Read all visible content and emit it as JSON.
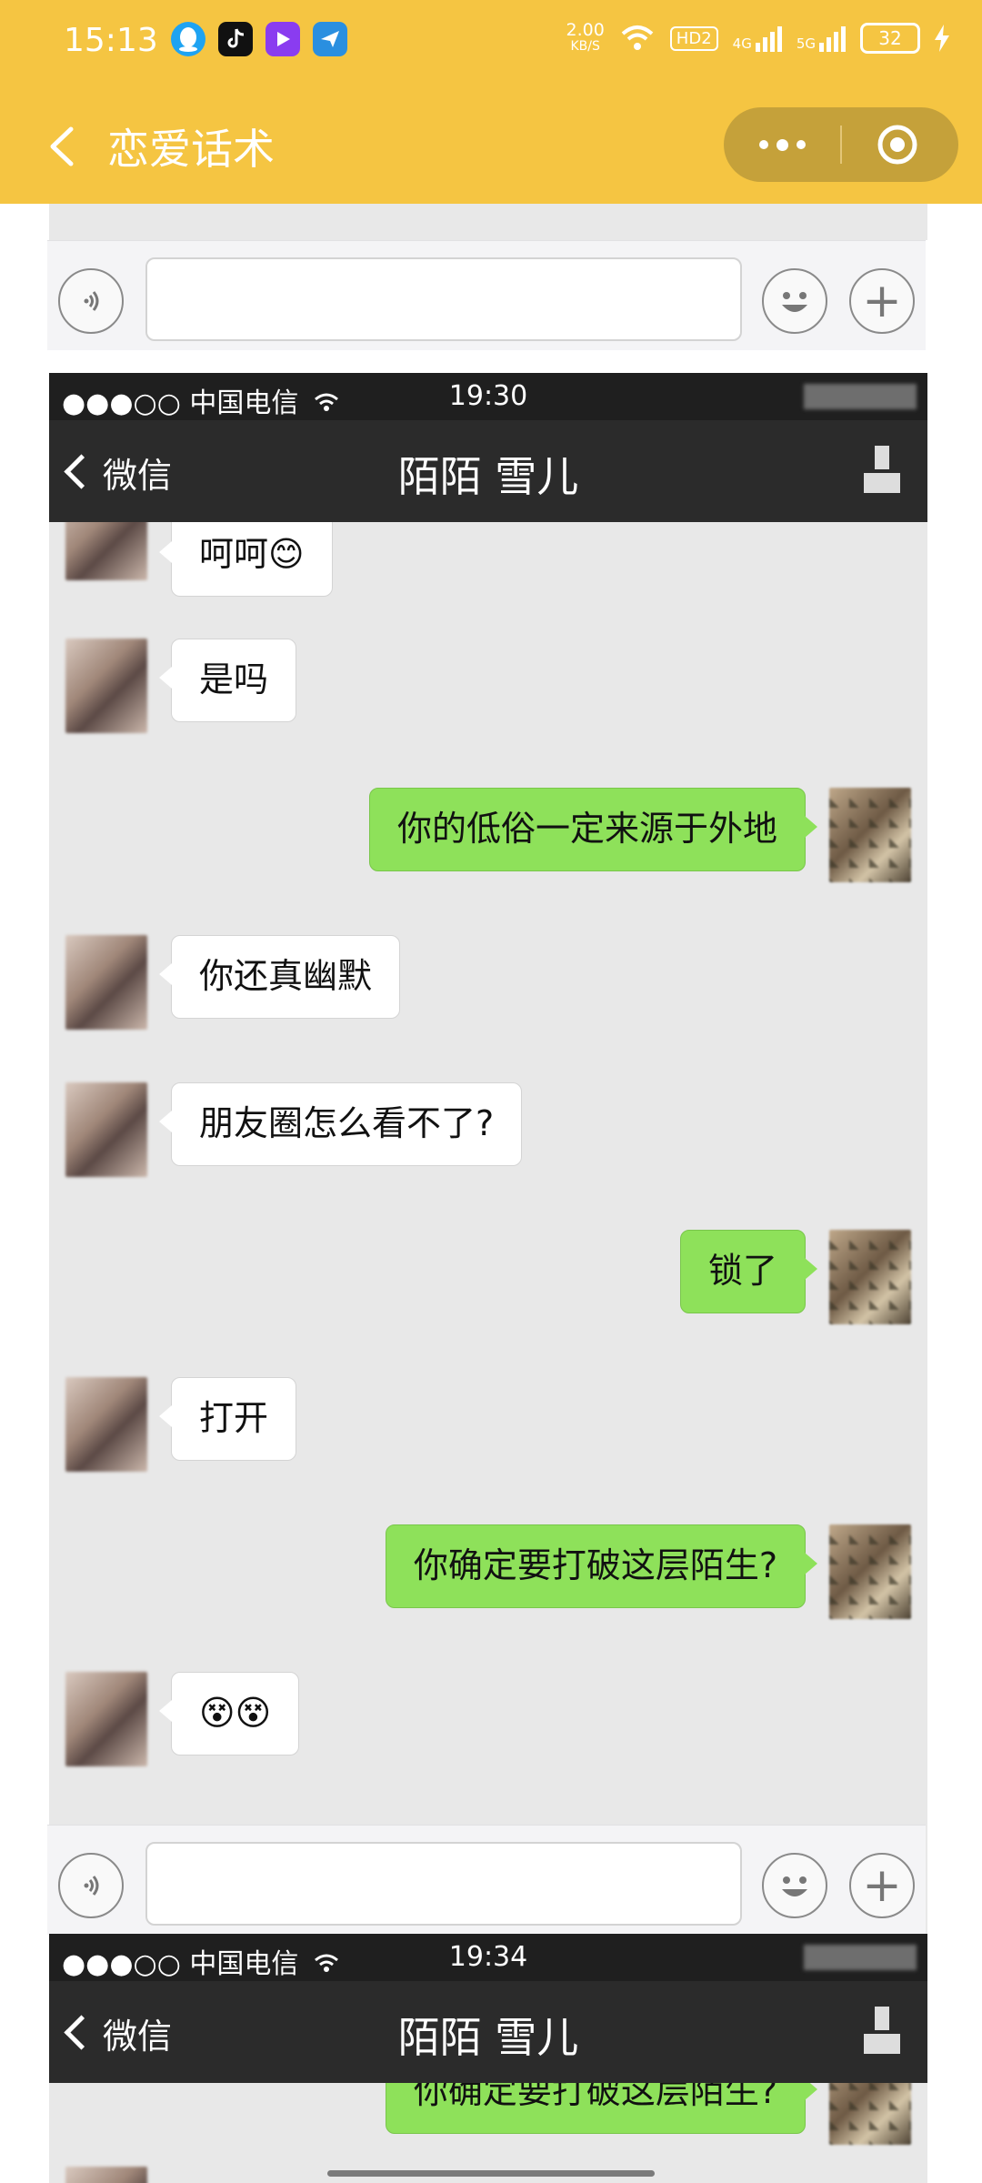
{
  "status_bar": {
    "time": "15:13",
    "speed_value": "2.00",
    "speed_unit": "KB/S",
    "hd_badge": "HD2",
    "net1": "4G",
    "net2": "5G",
    "battery": "32"
  },
  "header": {
    "title": "恋爱话术",
    "back_icon": "chevron-left-icon",
    "more_icon": "more-dots-icon",
    "close_icon": "target-circle-icon"
  },
  "screens": [
    {
      "carrier": "●●●○○ 中国电信",
      "time": "19:30",
      "back_label": "微信",
      "chat_title": "陌陌 雪儿"
    },
    {
      "carrier": "●●●○○ 中国电信",
      "time": "19:34",
      "back_label": "微信",
      "chat_title": "陌陌 雪儿",
      "partial_message": "你确定要打破这层陌生?"
    }
  ],
  "messages": [
    {
      "side": "left",
      "text": "呵呵😊"
    },
    {
      "side": "left",
      "text": "是吗"
    },
    {
      "side": "right",
      "text": "你的低俗一定来源于外地"
    },
    {
      "side": "left",
      "text": "你还真幽默"
    },
    {
      "side": "left",
      "text": "朋友圈怎么看不了?"
    },
    {
      "side": "right",
      "text": "锁了"
    },
    {
      "side": "left",
      "text": "打开"
    },
    {
      "side": "right",
      "text": "你确定要打破这层陌生?"
    },
    {
      "side": "left",
      "text": "😵😵"
    }
  ],
  "colors": {
    "brand_yellow": "#f5c542",
    "capsule": "#c5a13a",
    "wechat_green": "#8ee15a",
    "chat_bg": "#e8e8e8",
    "wechat_nav": "#2b2b2b"
  }
}
